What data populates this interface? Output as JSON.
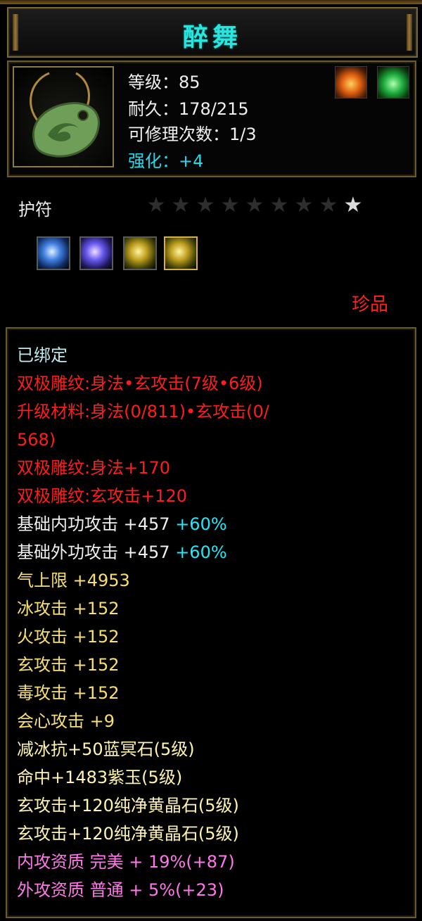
{
  "item": {
    "name": "醉舞",
    "level": "等级：85",
    "durability": "耐久：178/215",
    "repair_count": "可修理次数：1/3",
    "enhance": "强化：+4",
    "slot": "护符",
    "rarity": "珍品",
    "stars_total": 9,
    "stars_lit": 1,
    "element_icons": [
      "fire-icon",
      "wood-icon"
    ],
    "gems": [
      "blue-gem-icon",
      "purple-gem-icon",
      "yellow-gem-icon",
      "yellow-gem-icon"
    ]
  },
  "details": {
    "bound": "已绑定",
    "carve1": "双极雕纹:身法•玄攻击(7级•6级)",
    "upgrade_line1": "升级材料:身法(0/811)•玄攻击(0/",
    "upgrade_line2": "568)",
    "carve2": "双极雕纹:身法+170",
    "carve3": "双极雕纹:玄攻击+120",
    "inner_atk": "基础内功攻击 +457",
    "inner_atk_bonus": "+60%",
    "outer_atk": "基础外功攻击 +457",
    "outer_atk_bonus": "+60%",
    "qi_limit": "气上限 +4953",
    "ice_atk": "冰攻击 +152",
    "fire_atk": "火攻击 +152",
    "mystic_atk": "玄攻击 +152",
    "poison_atk": "毒攻击 +152",
    "crit_atk": "会心攻击 +9",
    "gem1": "减冰抗+50蓝冥石(5级)",
    "gem2": "命中+1483紫玉(5级)",
    "gem3": "玄攻击+120纯净黄晶石(5级)",
    "gem4": "玄攻击+120纯净黄晶石(5级)",
    "inner_quality": "内攻资质 完美 + 19%(+87)",
    "outer_quality": "外攻资质 普通 + 5%(+23)"
  },
  "colors": {
    "title": "#26e6e0",
    "enhance": "#22d8ee",
    "carve": "#ff1c1c",
    "bonus": "#22e8f8",
    "attribute": "#f8e070",
    "gem": "#fff4b0",
    "quality": "#ff78e8",
    "rarity": "#ff2020"
  }
}
